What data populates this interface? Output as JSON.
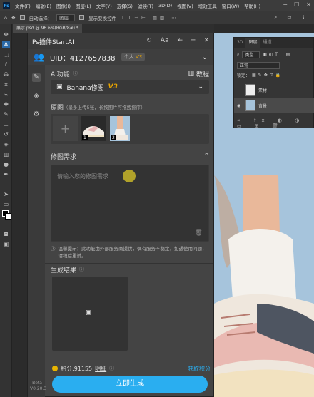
{
  "menubar": {
    "app_logo": "Ps",
    "items": [
      "文件(F)",
      "编辑(E)",
      "图像(I)",
      "图层(L)",
      "文字(Y)",
      "选择(S)",
      "滤镜(T)",
      "3D(D)",
      "视图(V)",
      "增效工具",
      "窗口(W)",
      "帮助(H)"
    ]
  },
  "optionsbar": {
    "auto_select": "自动选择：",
    "auto_select_value": "图层",
    "show_transform": "显示变换控件"
  },
  "document": {
    "tab": "展示.psd @ 96.6%(RGB/8#) *"
  },
  "layers_panel": {
    "tabs": [
      "3D",
      "图层",
      "通道"
    ],
    "filter_label": "类型",
    "mode": "正常",
    "lock_label": "锁定：",
    "layers": [
      {
        "name": "素材"
      },
      {
        "name": "背景"
      }
    ]
  },
  "plugin": {
    "title": "Ps插件StartAI",
    "uid": "UID：4127657838",
    "plan_label": "个人",
    "plan_version": "V3",
    "ai_function_label": "AI功能",
    "tutorial_label": "教程",
    "model_select": "Banana修图",
    "model_version": "V3",
    "original_label": "原图",
    "original_hint": "（最多上传5张，长按图片可拖拽排序）",
    "thumbs": [
      "1",
      "2"
    ],
    "edit_section_label": "修图需求",
    "prompt_placeholder": "请输入您的修图需求",
    "warm_tip": "温馨提示：此功能由外部服务商提供，偶有服务不稳定，如遇使用问题，请稍后重试。",
    "result_label": "生成结果",
    "points_label": "积分:91155",
    "details_label": "明细",
    "get_points_label": "获取积分",
    "generate_label": "立即生成",
    "beta_label": "Beta",
    "version_label": "V0.20.3"
  },
  "colors": {
    "accent": "#2aaef0",
    "version_badge": "#e8a400",
    "panel_bg": "#444444",
    "canvas_bg": "#a6c4dc"
  }
}
